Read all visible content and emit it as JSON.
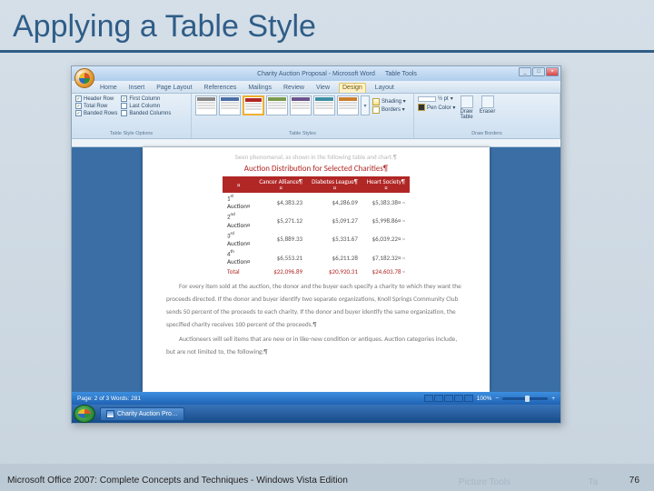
{
  "slide": {
    "title": "Applying a Table Style"
  },
  "window": {
    "doc_title": "Charity Auction Proposal - Microsoft Word",
    "context_tab": "Table Tools"
  },
  "tabs": {
    "home": "Home",
    "insert": "Insert",
    "page_layout": "Page Layout",
    "references": "References",
    "mailings": "Mailings",
    "review": "Review",
    "view": "View",
    "design": "Design",
    "layout": "Layout"
  },
  "ribbon": {
    "opts_label": "Table Style Options",
    "header_row": "Header Row",
    "total_row": "Total Row",
    "banded_rows": "Banded Rows",
    "first_col": "First Column",
    "last_col": "Last Column",
    "banded_cols": "Banded Columns",
    "styles_label": "Table Styles",
    "shading": "Shading ▾",
    "borders": "Borders ▾",
    "pen_weight": "½ pt",
    "pen_color": "Pen Color ▾",
    "draw_label": "Draw Borders",
    "draw_table": "Draw\nTable",
    "eraser": "Eraser"
  },
  "doc": {
    "cut_line": "been phenomenal, as shown in the following table and chart.¶",
    "heading": "Auction Distribution for Selected Charities¶",
    "body": "For every item sold at the auction, the donor and the buyer each specify a charity to which they want the proceeds directed. If the donor and buyer identify two separate organizations, Knoll Springs Community Club sends 50 percent of the proceeds to each charity. If the donor and buyer identify the same organization, the specified charity receives 100 percent of the proceeds.¶",
    "body2_start": "Auctioneers will sell items that are new or in like-new condition or antiques. Auction categories include, but are not limited to, the following:¶"
  },
  "chart_data": {
    "type": "table",
    "title": "Auction Distribution for Selected Charities",
    "columns": [
      "",
      "Cancer Alliance",
      "Diabetes League",
      "Heart Society"
    ],
    "rows": [
      {
        "label": "1st Auction",
        "values": [
          "$4,383.23",
          "$4,286.09",
          "$5,383.38"
        ]
      },
      {
        "label": "2nd Auction",
        "values": [
          "$5,271.12",
          "$5,091.27",
          "$5,998.86"
        ]
      },
      {
        "label": "3rd Auction",
        "values": [
          "$5,889.33",
          "$5,331.67",
          "$6,039.22"
        ]
      },
      {
        "label": "4th Auction",
        "values": [
          "$6,553.21",
          "$6,211.28",
          "$7,182.32"
        ]
      }
    ],
    "total": {
      "label": "Total",
      "values": [
        "$22,096.89",
        "$20,920.31",
        "$24,603.78"
      ]
    }
  },
  "status": {
    "left": "Page: 2 of 3    Words: 281",
    "zoom": "100%"
  },
  "taskbar": {
    "item": "Charity Auction Pro…"
  },
  "footer": {
    "text": "Microsoft Office 2007: Complete Concepts and Techniques - Windows Vista Edition",
    "page": "76",
    "ghost1": "Ta",
    "ghost2": "Picture Tools"
  }
}
